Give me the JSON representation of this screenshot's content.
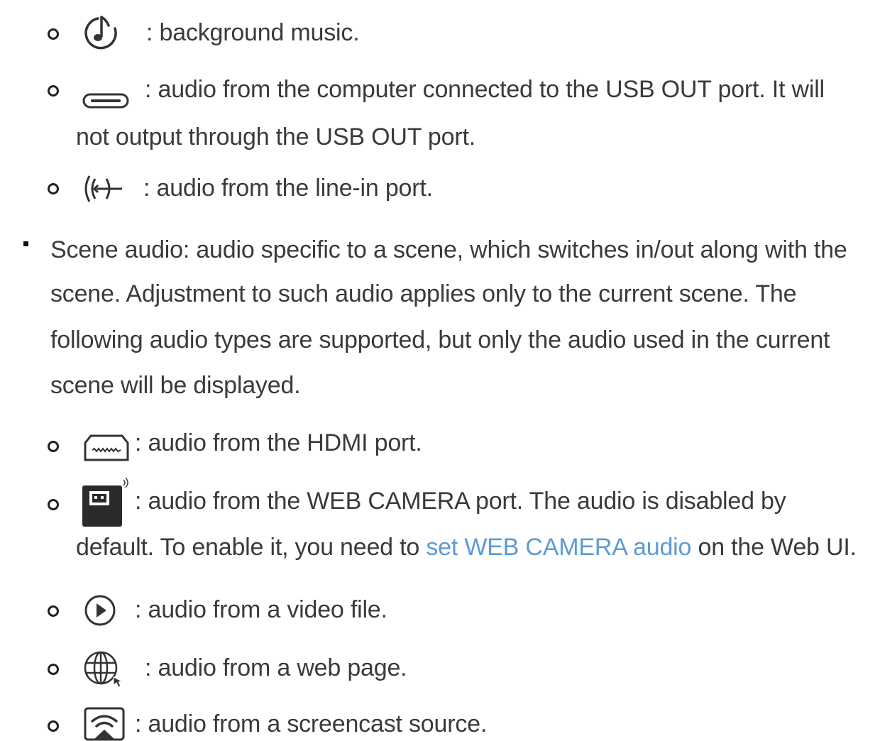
{
  "background_music": {
    "text": ": background music."
  },
  "usb_out": {
    "line1": ": audio from the computer connected to the USB OUT port. It will",
    "line2": "not output through the USB OUT port."
  },
  "line_in": {
    "text": ": audio from the line-in port."
  },
  "scene_audio": {
    "line1": "Scene audio: audio specific to a scene, which switches in/out along with the",
    "line2": "scene. Adjustment to such audio applies only to the current scene. The",
    "line3": "following audio types are supported, but only the audio used in the current",
    "line4": "scene will be displayed."
  },
  "hdmi": {
    "text": ": audio from the HDMI port."
  },
  "web_camera": {
    "line1": ": audio from the WEB CAMERA port. The audio is disabled by",
    "line2_before": "default. To enable it, you need to ",
    "line2_link": "set WEB CAMERA audio",
    "line2_after": " on the Web UI."
  },
  "video_file": {
    "text": ": audio from a video file."
  },
  "web_page": {
    "text": ": audio from a web page."
  },
  "screencast": {
    "text": ": audio from a screencast source."
  },
  "colors": {
    "link": "#5d9bd6",
    "text": "#3a3a3a"
  }
}
